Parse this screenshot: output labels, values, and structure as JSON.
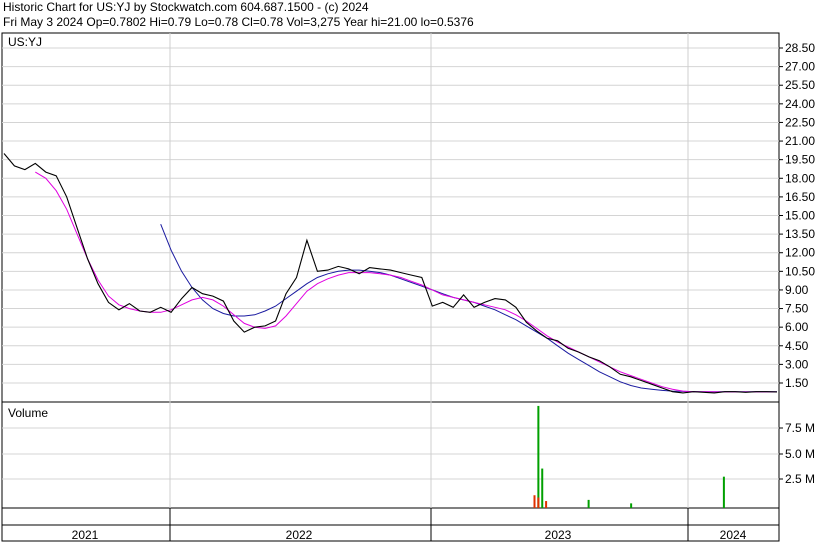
{
  "header": {
    "line1": "Historic Chart for US:YJ by Stockwatch.com 604.687.1500 - (c) 2024",
    "line2": "Fri May  3 2024   Op=0.7802   Hi=0.79   Lo=0.78   Cl=0.78   Vol=3,275   Year hi=21.00   lo=0.5376"
  },
  "chart_data": [
    {
      "type": "line",
      "title": "US:YJ",
      "x_ticks": [
        "2021",
        "2022",
        "2023",
        "2024"
      ],
      "ylim": [
        0,
        29.5
      ],
      "y_ticks": [
        "28.50",
        "27.00",
        "25.50",
        "24.00",
        "22.50",
        "21.00",
        "19.50",
        "18.00",
        "16.50",
        "15.00",
        "13.50",
        "12.00",
        "10.50",
        "9.00",
        "7.50",
        "6.00",
        "4.50",
        "3.00",
        "1.50"
      ],
      "grid": true,
      "colors": {
        "price": "#000000",
        "ma_short": "#e000e0",
        "ma_long": "#1a1aa0"
      },
      "series": [
        {
          "key": "price",
          "values": [
            20.0,
            19.0,
            18.7,
            19.2,
            18.5,
            18.2,
            16.5,
            14.0,
            11.5,
            9.5,
            8.0,
            7.4,
            7.9,
            7.3,
            7.2,
            7.6,
            7.2,
            8.3,
            9.2,
            8.7,
            8.5,
            8.1,
            6.5,
            5.6,
            6.0,
            6.1,
            6.5,
            8.7,
            10.0,
            13.0,
            10.5,
            10.6,
            10.9,
            10.7,
            10.3,
            10.8,
            10.7,
            10.6,
            10.4,
            10.2,
            10.0,
            7.7,
            8.0,
            7.6,
            8.6,
            7.6,
            8.0,
            8.3,
            8.2,
            7.6,
            6.4,
            5.7,
            5.1,
            4.9,
            4.3,
            4.0,
            3.6,
            3.3,
            2.8,
            2.2,
            2.0,
            1.7,
            1.4,
            1.1,
            0.8,
            0.7,
            0.8,
            0.75,
            0.7,
            0.8,
            0.8,
            0.75,
            0.8,
            0.8,
            0.78
          ]
        },
        {
          "key": "ma_short",
          "values": [
            null,
            null,
            null,
            18.5,
            18.0,
            17.0,
            15.5,
            13.5,
            11.5,
            9.8,
            8.5,
            7.8,
            7.5,
            7.3,
            7.2,
            7.2,
            7.4,
            7.8,
            8.2,
            8.4,
            8.2,
            7.7,
            7.0,
            6.3,
            6.0,
            5.9,
            6.1,
            6.9,
            7.9,
            8.9,
            9.5,
            9.9,
            10.2,
            10.4,
            10.4,
            10.4,
            10.3,
            10.2,
            10.0,
            9.7,
            9.4,
            9.0,
            8.6,
            8.4,
            8.2,
            8.0,
            7.8,
            7.6,
            7.4,
            7.0,
            6.5,
            5.9,
            5.3,
            4.8,
            4.4,
            4.0,
            3.6,
            3.2,
            2.8,
            2.4,
            2.1,
            1.8,
            1.5,
            1.2,
            1.0,
            0.85,
            0.8,
            0.8,
            0.78,
            0.78,
            0.78,
            0.78,
            0.78,
            0.78,
            0.78
          ]
        },
        {
          "key": "ma_long",
          "values": [
            null,
            null,
            null,
            null,
            null,
            null,
            null,
            null,
            null,
            null,
            null,
            null,
            null,
            null,
            null,
            14.3,
            12.2,
            10.5,
            9.2,
            8.2,
            7.5,
            7.1,
            6.9,
            6.9,
            7.0,
            7.3,
            7.7,
            8.3,
            8.9,
            9.5,
            10.0,
            10.3,
            10.5,
            10.6,
            10.6,
            10.5,
            10.4,
            10.2,
            9.9,
            9.6,
            9.3,
            9.0,
            8.7,
            8.4,
            8.2,
            8.0,
            7.7,
            7.4,
            7.0,
            6.6,
            6.1,
            5.6,
            5.1,
            4.5,
            3.9,
            3.4,
            2.9,
            2.4,
            2.0,
            1.6,
            1.3,
            1.1,
            1.0,
            0.9,
            0.85,
            0.82,
            0.81,
            0.8,
            0.8,
            0.8,
            0.8,
            0.8,
            0.8,
            0.8,
            0.8
          ]
        }
      ]
    },
    {
      "type": "bar",
      "title": "Volume",
      "ylim": [
        0,
        9.5
      ],
      "y_ticks": [
        "7.5 M",
        "5.0 M",
        "2.5 M"
      ],
      "grid": true,
      "bars": [
        {
          "t": 0.69,
          "value": 8.8,
          "color": "#00a000"
        },
        {
          "t": 0.695,
          "value": 3.4,
          "color": "#00a000"
        },
        {
          "t": 0.685,
          "value": 1.1,
          "color": "#e03000"
        },
        {
          "t": 0.69,
          "value": 0.9,
          "color": "#e03000"
        },
        {
          "t": 0.7,
          "value": 0.6,
          "color": "#e03000"
        },
        {
          "t": 0.755,
          "value": 0.7,
          "color": "#00a000"
        },
        {
          "t": 0.81,
          "value": 0.4,
          "color": "#00a000"
        },
        {
          "t": 0.93,
          "value": 2.7,
          "color": "#00a000"
        }
      ]
    }
  ]
}
